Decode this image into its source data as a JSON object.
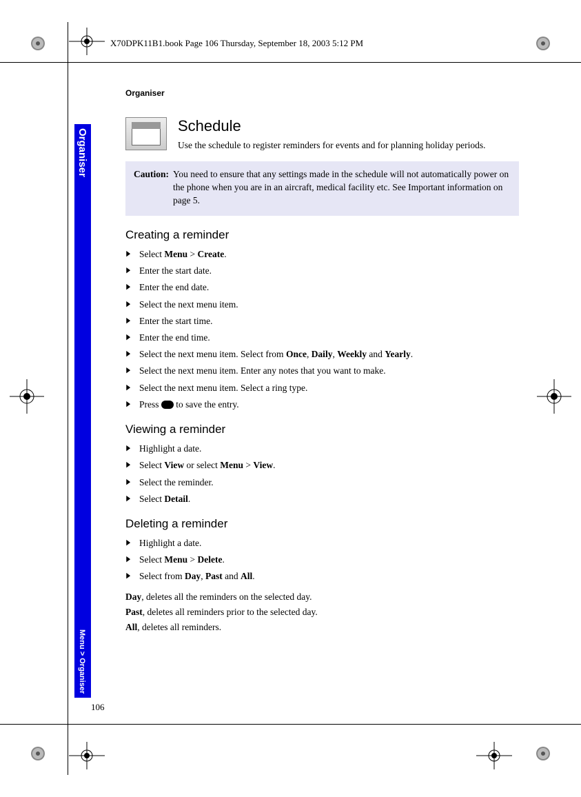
{
  "header": {
    "crop_text": "X70DPK11B1.book  Page 106  Thursday, September 18, 2003  5:12 PM"
  },
  "sidebar": {
    "section": "Organiser",
    "breadcrumb": "Menu > Organiser"
  },
  "page": {
    "running_header": "Organiser",
    "number": "106"
  },
  "schedule": {
    "title": "Schedule",
    "intro": "Use the schedule to register reminders for events and for planning holiday periods."
  },
  "caution": {
    "label": "Caution:",
    "body": "You need to ensure that any settings made in the schedule will not automatically power on the phone when you are in an aircraft, medical facility etc. See Important information on page 5."
  },
  "sections": {
    "create": {
      "title": "Creating a reminder",
      "steps": [
        {
          "pre": "Select ",
          "b1": "Menu",
          "mid": " > ",
          "b2": "Create",
          "post": "."
        },
        {
          "pre": "Enter the start date.",
          "b1": "",
          "mid": "",
          "b2": "",
          "post": ""
        },
        {
          "pre": "Enter the end date.",
          "b1": "",
          "mid": "",
          "b2": "",
          "post": ""
        },
        {
          "pre": "Select the next menu item.",
          "b1": "",
          "mid": "",
          "b2": "",
          "post": ""
        },
        {
          "pre": "Enter the start time.",
          "b1": "",
          "mid": "",
          "b2": "",
          "post": ""
        },
        {
          "pre": "Enter the end time.",
          "b1": "",
          "mid": "",
          "b2": "",
          "post": ""
        }
      ],
      "step_repeat": {
        "pre": "Select the next menu item. Select from ",
        "b1": "Once",
        "mid1": ", ",
        "b2": "Daily",
        "mid2": ", ",
        "b3": "Weekly",
        "mid3": " and ",
        "b4": "Yearly",
        "post": "."
      },
      "step_notes": "Select the next menu item. Enter any notes that you want to make.",
      "step_ring": "Select the next menu item. Select a ring type.",
      "step_save_pre": "Press ",
      "step_save_post": " to save the entry."
    },
    "view": {
      "title": "Viewing a reminder",
      "steps": [
        "Highlight a date."
      ],
      "step_view": {
        "pre": "Select ",
        "b1": "View",
        "mid1": " or select ",
        "b2": "Menu",
        "mid2": " > ",
        "b3": "View",
        "post": "."
      },
      "step_sel": "Select the reminder.",
      "step_detail_pre": "Select ",
      "step_detail_b": "Detail",
      "step_detail_post": "."
    },
    "delete": {
      "title": "Deleting a reminder",
      "step_hl": "Highlight a date.",
      "step_menu": {
        "pre": "Select ",
        "b1": "Menu",
        "mid": " > ",
        "b2": "Delete",
        "post": "."
      },
      "step_from": {
        "pre": "Select from ",
        "b1": "Day",
        "mid1": ", ",
        "b2": "Past",
        "mid2": " and ",
        "b3": "All",
        "post": "."
      },
      "p_day": {
        "b": "Day",
        "t": ", deletes all the reminders on the selected day."
      },
      "p_past": {
        "b": "Past",
        "t": ", deletes all reminders prior to the selected day."
      },
      "p_all": {
        "b": "All",
        "t": ", deletes all reminders."
      }
    }
  }
}
